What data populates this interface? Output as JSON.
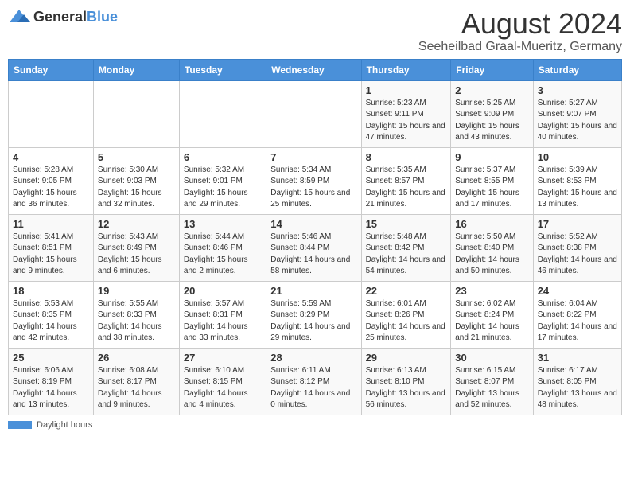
{
  "header": {
    "logo": {
      "general": "General",
      "blue": "Blue"
    },
    "title": "August 2024",
    "subtitle": "Seeheilbad Graal-Mueritz, Germany"
  },
  "calendar": {
    "weekdays": [
      "Sunday",
      "Monday",
      "Tuesday",
      "Wednesday",
      "Thursday",
      "Friday",
      "Saturday"
    ],
    "weeks": [
      [
        {
          "day": null,
          "info": null
        },
        {
          "day": null,
          "info": null
        },
        {
          "day": null,
          "info": null
        },
        {
          "day": null,
          "info": null
        },
        {
          "day": "1",
          "sunrise": "5:23 AM",
          "sunset": "9:11 PM",
          "daylight": "15 hours and 47 minutes."
        },
        {
          "day": "2",
          "sunrise": "5:25 AM",
          "sunset": "9:09 PM",
          "daylight": "15 hours and 43 minutes."
        },
        {
          "day": "3",
          "sunrise": "5:27 AM",
          "sunset": "9:07 PM",
          "daylight": "15 hours and 40 minutes."
        }
      ],
      [
        {
          "day": "4",
          "sunrise": "5:28 AM",
          "sunset": "9:05 PM",
          "daylight": "15 hours and 36 minutes."
        },
        {
          "day": "5",
          "sunrise": "5:30 AM",
          "sunset": "9:03 PM",
          "daylight": "15 hours and 32 minutes."
        },
        {
          "day": "6",
          "sunrise": "5:32 AM",
          "sunset": "9:01 PM",
          "daylight": "15 hours and 29 minutes."
        },
        {
          "day": "7",
          "sunrise": "5:34 AM",
          "sunset": "8:59 PM",
          "daylight": "15 hours and 25 minutes."
        },
        {
          "day": "8",
          "sunrise": "5:35 AM",
          "sunset": "8:57 PM",
          "daylight": "15 hours and 21 minutes."
        },
        {
          "day": "9",
          "sunrise": "5:37 AM",
          "sunset": "8:55 PM",
          "daylight": "15 hours and 17 minutes."
        },
        {
          "day": "10",
          "sunrise": "5:39 AM",
          "sunset": "8:53 PM",
          "daylight": "15 hours and 13 minutes."
        }
      ],
      [
        {
          "day": "11",
          "sunrise": "5:41 AM",
          "sunset": "8:51 PM",
          "daylight": "15 hours and 9 minutes."
        },
        {
          "day": "12",
          "sunrise": "5:43 AM",
          "sunset": "8:49 PM",
          "daylight": "15 hours and 6 minutes."
        },
        {
          "day": "13",
          "sunrise": "5:44 AM",
          "sunset": "8:46 PM",
          "daylight": "15 hours and 2 minutes."
        },
        {
          "day": "14",
          "sunrise": "5:46 AM",
          "sunset": "8:44 PM",
          "daylight": "14 hours and 58 minutes."
        },
        {
          "day": "15",
          "sunrise": "5:48 AM",
          "sunset": "8:42 PM",
          "daylight": "14 hours and 54 minutes."
        },
        {
          "day": "16",
          "sunrise": "5:50 AM",
          "sunset": "8:40 PM",
          "daylight": "14 hours and 50 minutes."
        },
        {
          "day": "17",
          "sunrise": "5:52 AM",
          "sunset": "8:38 PM",
          "daylight": "14 hours and 46 minutes."
        }
      ],
      [
        {
          "day": "18",
          "sunrise": "5:53 AM",
          "sunset": "8:35 PM",
          "daylight": "14 hours and 42 minutes."
        },
        {
          "day": "19",
          "sunrise": "5:55 AM",
          "sunset": "8:33 PM",
          "daylight": "14 hours and 38 minutes."
        },
        {
          "day": "20",
          "sunrise": "5:57 AM",
          "sunset": "8:31 PM",
          "daylight": "14 hours and 33 minutes."
        },
        {
          "day": "21",
          "sunrise": "5:59 AM",
          "sunset": "8:29 PM",
          "daylight": "14 hours and 29 minutes."
        },
        {
          "day": "22",
          "sunrise": "6:01 AM",
          "sunset": "8:26 PM",
          "daylight": "14 hours and 25 minutes."
        },
        {
          "day": "23",
          "sunrise": "6:02 AM",
          "sunset": "8:24 PM",
          "daylight": "14 hours and 21 minutes."
        },
        {
          "day": "24",
          "sunrise": "6:04 AM",
          "sunset": "8:22 PM",
          "daylight": "14 hours and 17 minutes."
        }
      ],
      [
        {
          "day": "25",
          "sunrise": "6:06 AM",
          "sunset": "8:19 PM",
          "daylight": "14 hours and 13 minutes."
        },
        {
          "day": "26",
          "sunrise": "6:08 AM",
          "sunset": "8:17 PM",
          "daylight": "14 hours and 9 minutes."
        },
        {
          "day": "27",
          "sunrise": "6:10 AM",
          "sunset": "8:15 PM",
          "daylight": "14 hours and 4 minutes."
        },
        {
          "day": "28",
          "sunrise": "6:11 AM",
          "sunset": "8:12 PM",
          "daylight": "14 hours and 0 minutes."
        },
        {
          "day": "29",
          "sunrise": "6:13 AM",
          "sunset": "8:10 PM",
          "daylight": "13 hours and 56 minutes."
        },
        {
          "day": "30",
          "sunrise": "6:15 AM",
          "sunset": "8:07 PM",
          "daylight": "13 hours and 52 minutes."
        },
        {
          "day": "31",
          "sunrise": "6:17 AM",
          "sunset": "8:05 PM",
          "daylight": "13 hours and 48 minutes."
        }
      ]
    ]
  },
  "footer": {
    "label": "Daylight hours"
  }
}
